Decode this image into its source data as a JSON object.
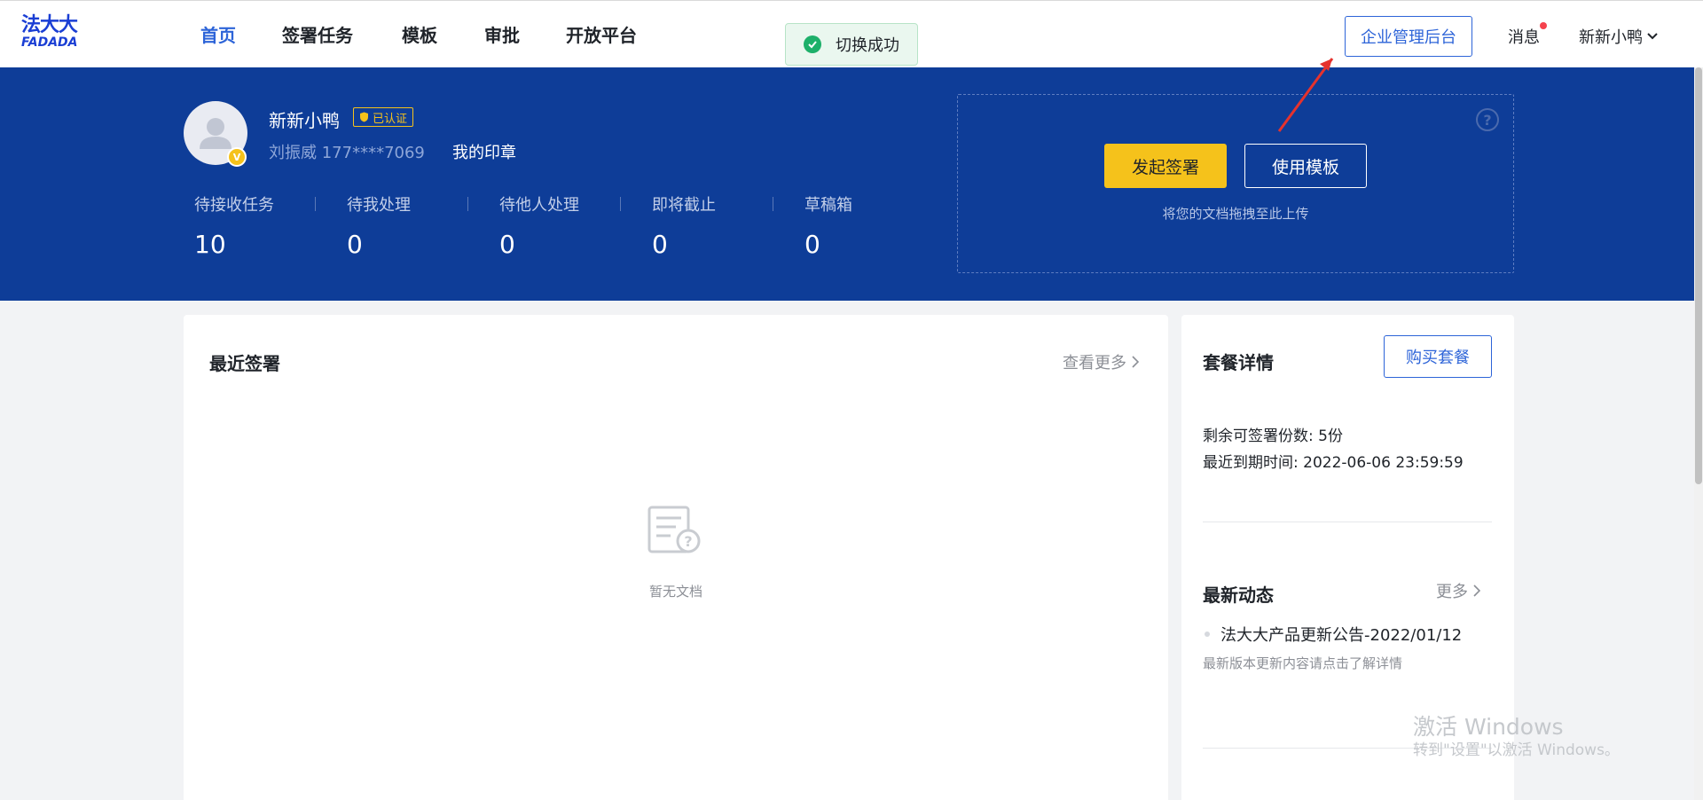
{
  "brand": {
    "logo_cn": "法大大",
    "logo_en": "FADADA"
  },
  "nav": {
    "items": [
      {
        "label": "首页",
        "active": true
      },
      {
        "label": "签署任务"
      },
      {
        "label": "模板"
      },
      {
        "label": "审批"
      },
      {
        "label": "开放平台"
      }
    ],
    "toast": "切换成功",
    "admin_button": "企业管理后台",
    "messages": "消息",
    "user_menu": "新新小鸭"
  },
  "profile": {
    "name": "新新小鸭",
    "verified_badge": "已认证",
    "realname_phone": "刘振威 177****7069",
    "my_seal": "我的印章",
    "stats": [
      {
        "label": "待接收任务",
        "value": "10"
      },
      {
        "label": "待我处理",
        "value": "0"
      },
      {
        "label": "待他人处理",
        "value": "0"
      },
      {
        "label": "即将截止",
        "value": "0"
      },
      {
        "label": "草稿箱",
        "value": "0"
      }
    ]
  },
  "upload": {
    "start_sign": "发起签署",
    "use_template": "使用模板",
    "hint": "将您的文档拖拽至此上传",
    "help": "?"
  },
  "recent": {
    "title": "最近签署",
    "more": "查看更多",
    "empty_text": "暂无文档"
  },
  "plan": {
    "title": "套餐详情",
    "buy_button": "购买套餐",
    "remaining": "剩余可签署份数: 5份",
    "expiry": "最近到期时间: 2022-06-06 23:59:59"
  },
  "news": {
    "title": "最新动态",
    "more": "更多",
    "items": [
      {
        "title": "法大大产品更新公告-2022/01/12",
        "desc": "最新版本更新内容请点击了解详情"
      }
    ]
  },
  "watermark": {
    "line1": "激活 Windows",
    "line2": "转到\"设置\"以激活 Windows。"
  },
  "colors": {
    "brand_blue": "#0e3d98",
    "accent_blue": "#2d64d8",
    "accent_yellow": "#f5c21b",
    "success_green": "#1db06a",
    "annotation_red": "#e5322d"
  }
}
